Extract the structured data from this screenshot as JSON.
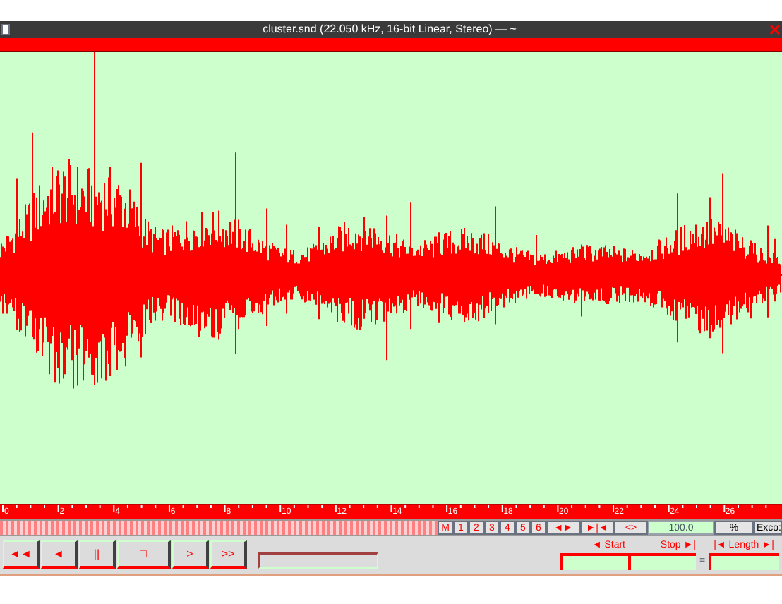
{
  "window": {
    "title": "cluster.snd (22.050 kHz, 16-bit Linear, Stereo) — ~"
  },
  "waveform": {
    "kind": "picture"
  },
  "ruler": {
    "labels": [
      "0",
      "2",
      "4",
      "6",
      "8",
      "10",
      "12",
      "14",
      "16",
      "18",
      "20",
      "22",
      "24",
      "26"
    ]
  },
  "channel_buttons": [
    "M",
    "1",
    "2",
    "3",
    "4",
    "5",
    "6"
  ],
  "zoom_buttons": [
    "◄►",
    "►|◄",
    "<>"
  ],
  "zoom_field": {
    "value": "100.0"
  },
  "percent_button": "%",
  "extra_button": "Exco:",
  "transport_buttons": [
    "◄◄",
    "◄",
    "||",
    "□",
    ">",
    ">>"
  ],
  "selection": {
    "start_label": "◄ Start",
    "stop_label": "Stop ►|",
    "equals": "=",
    "length_label": "|◄ Length ►|"
  }
}
